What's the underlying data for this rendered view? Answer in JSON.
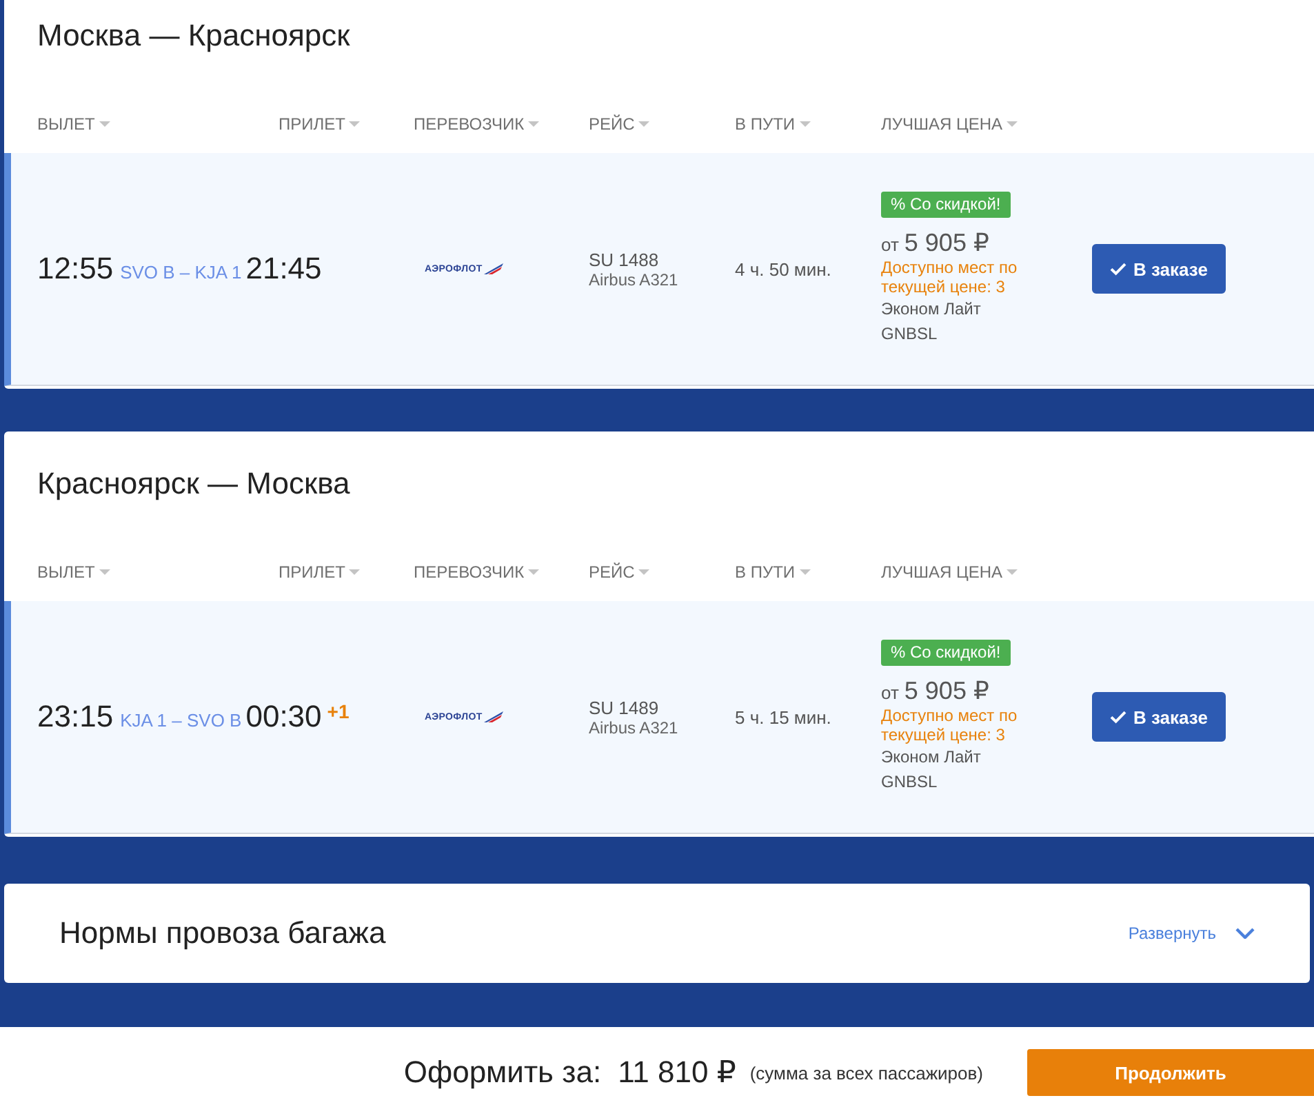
{
  "legs": [
    {
      "title": "Москва — Красноярск",
      "columns": [
        "ВЫЛЕТ",
        "ПРИЛЕТ",
        "ПЕРЕВОЗЧИК",
        "РЕЙС",
        "В ПУТИ",
        "ЛУЧШАЯ ЦЕНА"
      ],
      "flight": {
        "selected": true,
        "departure_time": "12:55",
        "route": "SVO B – KJA 1",
        "arrival_time": "21:45",
        "carrier": "АЭРОФЛОТ",
        "flight_number": "SU 1488",
        "aircraft": "Airbus A321",
        "duration": "4 ч. 50 мин.",
        "badge": "% Со скидкой!",
        "price_prefix": "от",
        "price": "5 905 ₽",
        "availability": "Доступно мест по текущей цене: 3",
        "fare_class": "Эконом Лайт",
        "fare_code": "GNBSL",
        "button": "В заказе"
      }
    },
    {
      "title": "Красноярск — Москва",
      "columns": [
        "ВЫЛЕТ",
        "ПРИЛЕТ",
        "ПЕРЕВОЗЧИК",
        "РЕЙС",
        "В ПУТИ",
        "ЛУЧШАЯ ЦЕНА"
      ],
      "flight": {
        "selected": true,
        "departure_time": "23:15",
        "route": "KJA 1 – SVO B",
        "arrival_time": "00:30",
        "day_offset": "+1",
        "carrier": "АЭРОФЛОТ",
        "flight_number": "SU 1489",
        "aircraft": "Airbus A321",
        "duration": "5 ч. 15 мин.",
        "badge": "% Со скидкой!",
        "price_prefix": "от",
        "price": "5 905 ₽",
        "availability": "Доступно мест по текущей цене: 3",
        "fare_class": "Эконом Лайт",
        "fare_code": "GNBSL",
        "button": "В заказе"
      }
    }
  ],
  "baggage": {
    "title": "Нормы провоза багажа",
    "toggle": "Развернуть",
    "expanded": false
  },
  "footer": {
    "label": "Оформить за:",
    "total": "11 810 ₽",
    "note": "(сумма за всех пассажиров)",
    "button": "Продолжить"
  }
}
